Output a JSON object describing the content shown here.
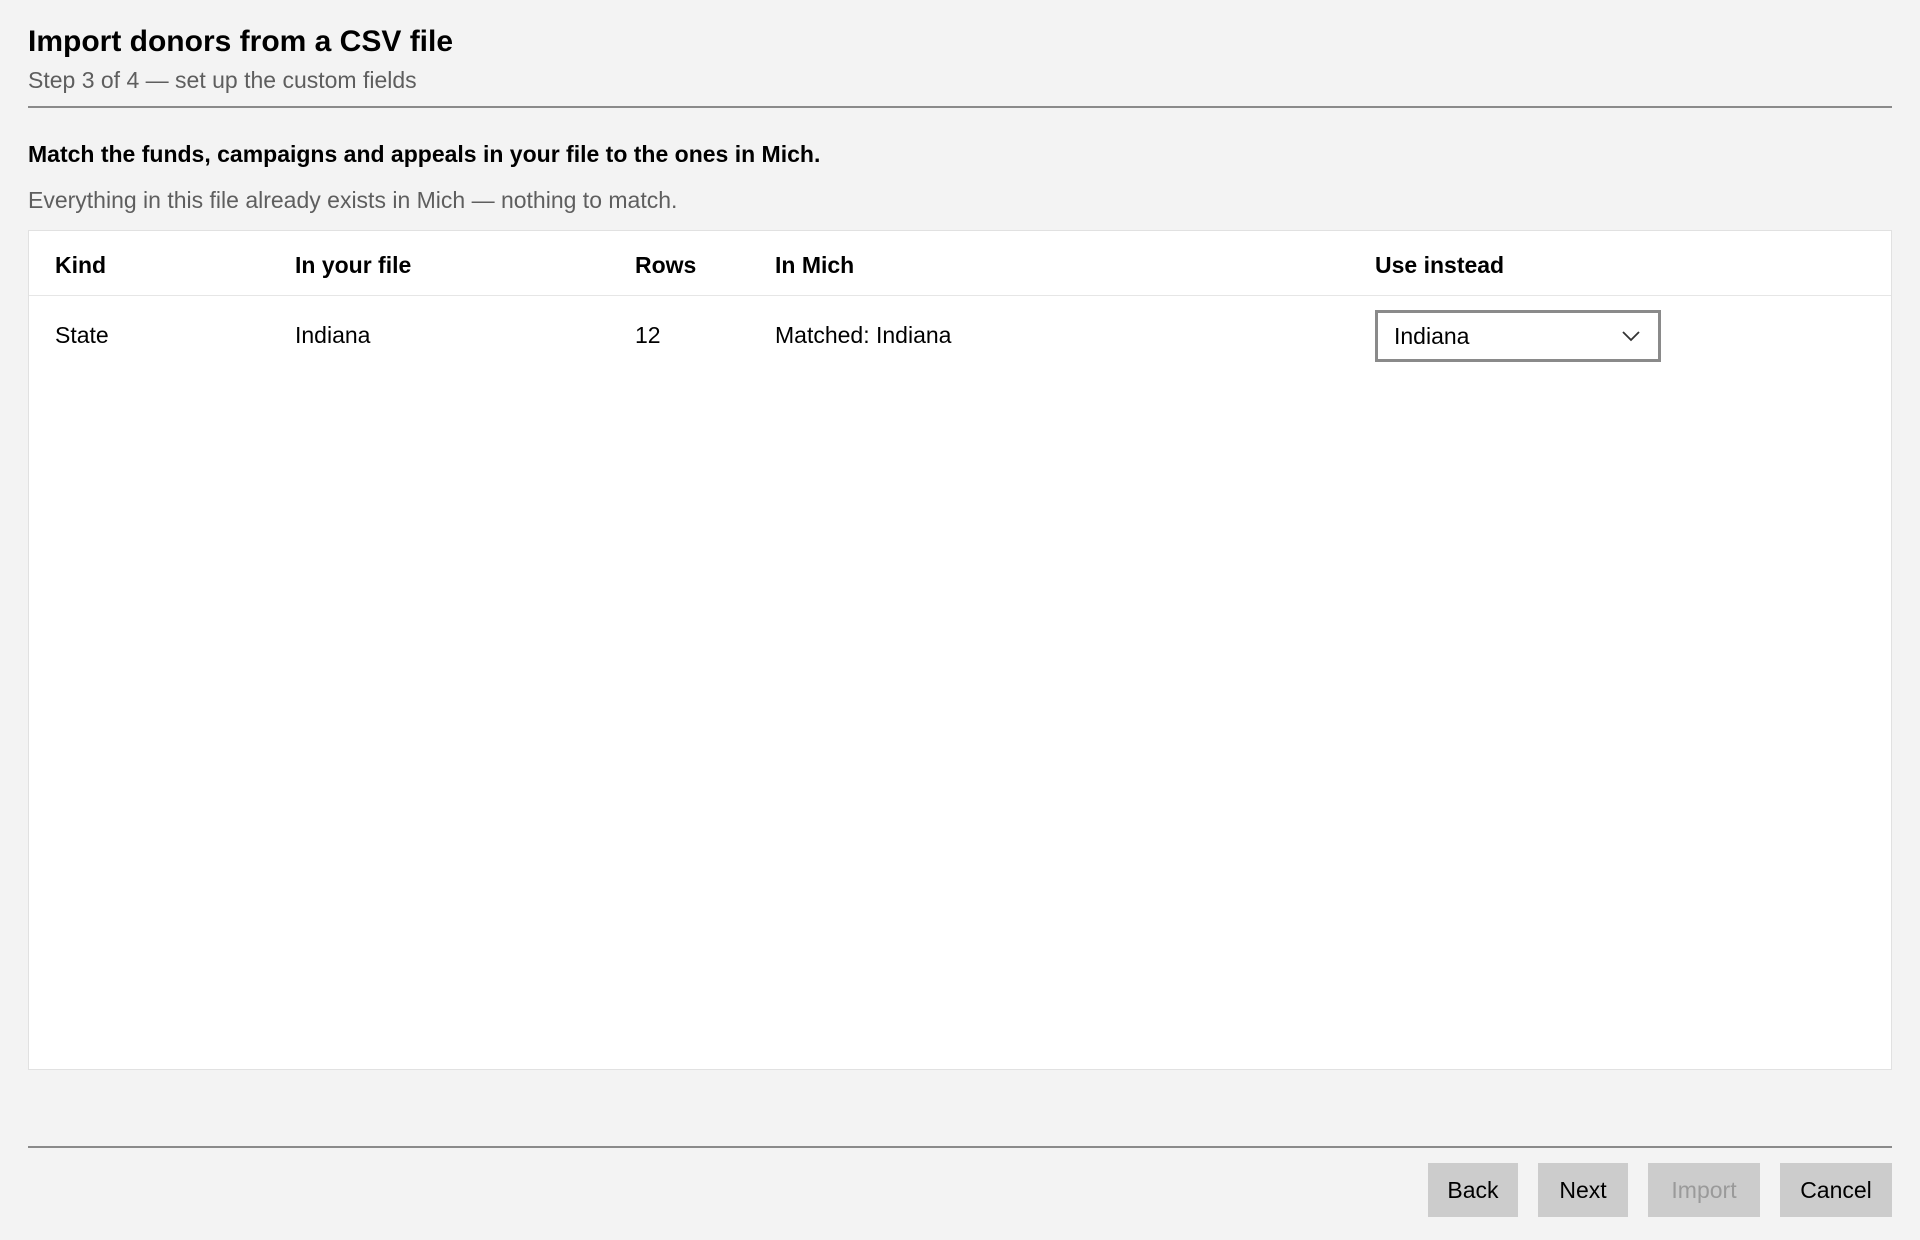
{
  "header": {
    "title": "Import donors from a CSV file",
    "subtitle": "Step 3 of 4 — set up the custom fields"
  },
  "instruction": "Match the funds, campaigns and appeals in your file to the ones in Mich.",
  "note": "Everything in this file already exists in Mich — nothing to match.",
  "table": {
    "columns": [
      "Kind",
      "In your file",
      "Rows",
      "In Mich",
      "Use instead"
    ],
    "rows": [
      {
        "kind": "State",
        "in_file": "Indiana",
        "rows": "12",
        "in_mich": "Matched: Indiana",
        "use_instead": "Indiana"
      }
    ]
  },
  "footer": {
    "back_label": "Back",
    "next_label": "Next",
    "import_label": "Import",
    "cancel_label": "Cancel",
    "import_disabled": true
  },
  "icons": {
    "dropdown": "chevron-down-icon"
  },
  "colors": {
    "background": "#f3f3f3",
    "panel": "#ffffff",
    "button": "#cccccc",
    "rule": "#8a8a8a",
    "secondary_text": "#5e5e5e",
    "disabled_text": "#9a9a9a"
  }
}
